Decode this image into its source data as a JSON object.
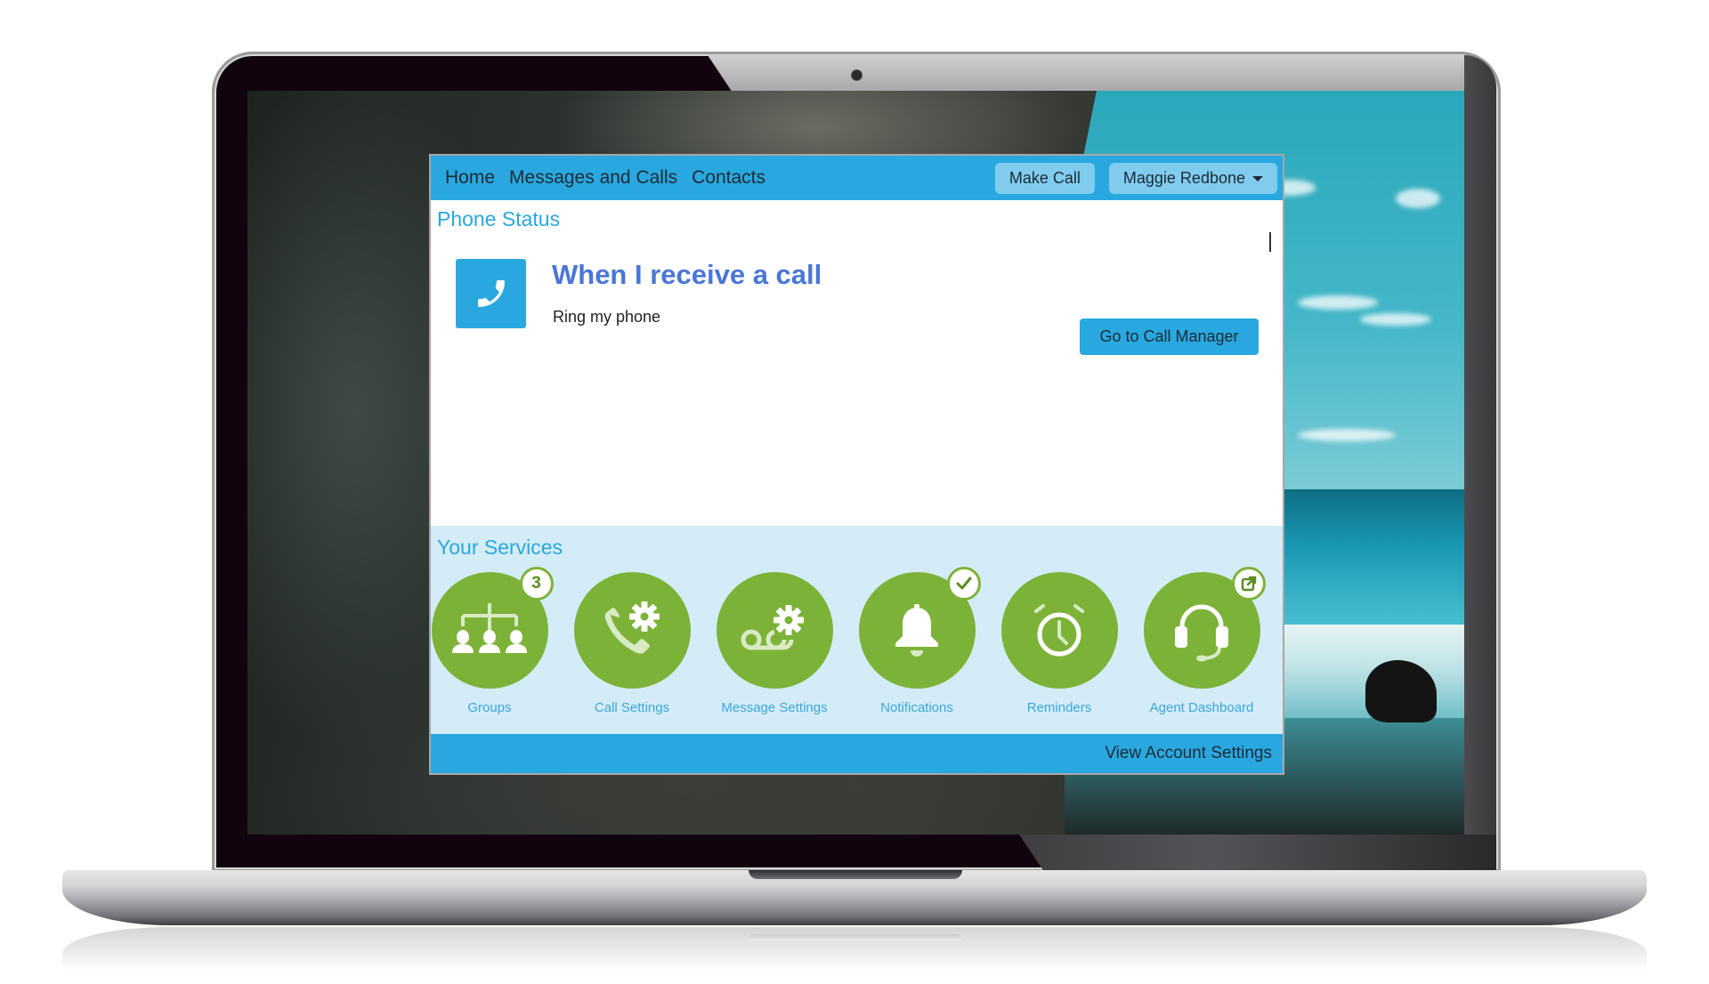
{
  "nav": {
    "links": [
      "Home",
      "Messages and Calls",
      "Contacts"
    ],
    "make_call_label": "Make Call",
    "user_menu_label": "Maggie Redbone"
  },
  "phone_status": {
    "section_title": "Phone Status",
    "icon": "phone-icon",
    "heading": "When I receive a call",
    "subtext": "Ring my phone",
    "call_manager_button": "Go to Call Manager"
  },
  "services": {
    "section_title": "Your Services",
    "items": [
      {
        "label": "Groups",
        "icon": "groups-icon",
        "badge": "3",
        "badge_type": "count"
      },
      {
        "label": "Call Settings",
        "icon": "call-settings-icon"
      },
      {
        "label": "Message Settings",
        "icon": "voicemail-settings-icon"
      },
      {
        "label": "Notifications",
        "icon": "bell-icon",
        "badge_type": "check"
      },
      {
        "label": "Reminders",
        "icon": "alarm-clock-icon"
      },
      {
        "label": "Agent Dashboard",
        "icon": "headset-icon",
        "badge_type": "external-link"
      }
    ]
  },
  "footer": {
    "account_settings_label": "View Account Settings"
  },
  "colors": {
    "brand_blue": "#29a8e0",
    "button_light_blue": "#80ccef",
    "services_bg": "#d4ecf8",
    "service_green": "#7db238",
    "heading_blue": "#4a76d6"
  }
}
